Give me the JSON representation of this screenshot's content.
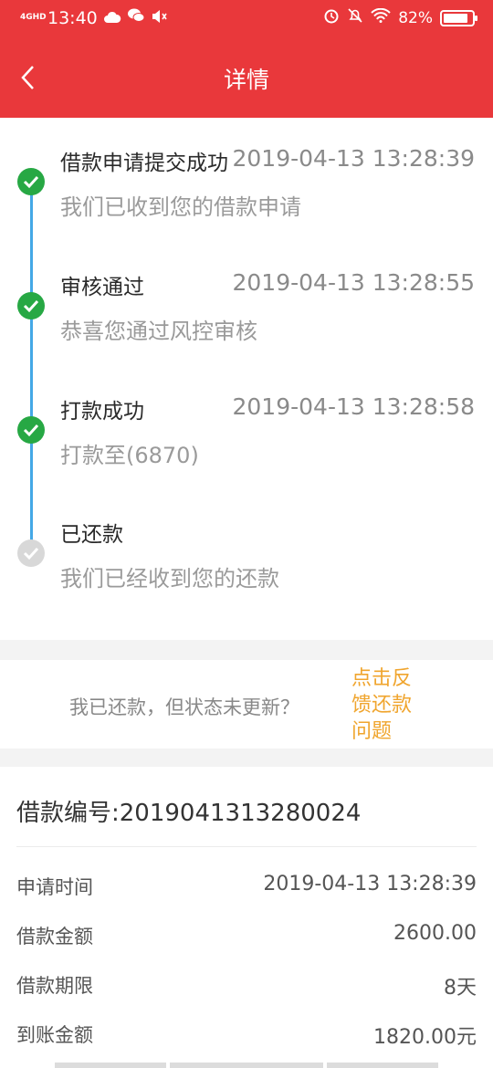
{
  "status_bar": {
    "network": "4GHD",
    "time": "13:40",
    "battery": "82%"
  },
  "nav": {
    "title": "详情"
  },
  "timeline": [
    {
      "title": "借款申请提交成功",
      "time": "2019-04-13 13:28:39",
      "desc": "我们已收到您的借款申请",
      "state": "done"
    },
    {
      "title": "审核通过",
      "time": "2019-04-13 13:28:55",
      "desc": "恭喜您通过风控审核",
      "state": "done"
    },
    {
      "title": "打款成功",
      "time": "2019-04-13 13:28:58",
      "desc": "打款至(6870)",
      "state": "done"
    },
    {
      "title": "已还款",
      "time": "",
      "desc": "我们已经收到您的还款",
      "state": "pending"
    }
  ],
  "feedback": {
    "text": "我已还款，但状态未更新？",
    "link": "点击反馈还款问题"
  },
  "detail": {
    "loan_no": "借款编号:2019041313280024",
    "rows": [
      {
        "label": "申请时间",
        "value": "2019-04-13 13:28:39"
      },
      {
        "label": "借款金额",
        "value": "2600.00"
      },
      {
        "label": "借款期限",
        "value": "8天"
      },
      {
        "label": "到账金额",
        "value": "1820.00元"
      }
    ]
  },
  "colors": {
    "header": "#e9383b",
    "check_done": "#27a844",
    "timeline_line": "#44a8e6",
    "link": "#f0a52e"
  }
}
